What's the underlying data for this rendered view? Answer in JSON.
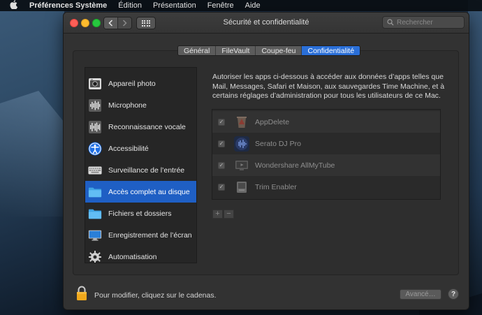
{
  "menubar": {
    "app_name": "Préférences Système",
    "items": [
      "Édition",
      "Présentation",
      "Fenêtre",
      "Aide"
    ]
  },
  "window": {
    "title": "Sécurité et confidentialité",
    "search_placeholder": "Rechercher"
  },
  "tabs": [
    {
      "label": "Général",
      "active": false
    },
    {
      "label": "FileVault",
      "active": false
    },
    {
      "label": "Coupe-feu",
      "active": false
    },
    {
      "label": "Confidentialité",
      "active": true
    }
  ],
  "sidebar": {
    "items": [
      {
        "label": "Appareil photo",
        "icon": "camera-icon",
        "selected": false
      },
      {
        "label": "Microphone",
        "icon": "microphone-icon",
        "selected": false
      },
      {
        "label": "Reconnaissance vocale",
        "icon": "speech-recognition-icon",
        "selected": false
      },
      {
        "label": "Accessibilité",
        "icon": "accessibility-icon",
        "selected": false
      },
      {
        "label": "Surveillance de l’entrée",
        "icon": "keyboard-icon",
        "selected": false
      },
      {
        "label": "Accès complet au disque",
        "icon": "folder-icon",
        "selected": true
      },
      {
        "label": "Fichiers et dossiers",
        "icon": "folder-icon",
        "selected": false
      },
      {
        "label": "Enregistrement de l’écran",
        "icon": "display-icon",
        "selected": false
      },
      {
        "label": "Automatisation",
        "icon": "gear-icon",
        "selected": false
      }
    ]
  },
  "main": {
    "description": "Autoriser les apps ci-dessous à accéder aux données d’apps telles que Mail, Messages, Safari et Maison, aux sauvegardes Time Machine, et à certains réglages d’administration pour tous les utilisateurs de ce Mac.",
    "apps": [
      {
        "name": "AppDelete",
        "checked": true,
        "icon": "appdelete-icon"
      },
      {
        "name": "Serato DJ Pro",
        "checked": true,
        "icon": "serato-icon"
      },
      {
        "name": "Wondershare AllMyTube",
        "checked": true,
        "icon": "allmytube-icon"
      },
      {
        "name": "Trim Enabler",
        "checked": true,
        "icon": "trim-enabler-icon"
      }
    ],
    "add_label": "+",
    "remove_label": "−"
  },
  "footer": {
    "lock_text": "Pour modifier, cliquez sur le cadenas.",
    "advanced_label": "Avancé…",
    "help_label": "?"
  },
  "colors": {
    "accent": "#2a6fd8",
    "selection": "#1f5fc4",
    "window_bg": "#323232"
  }
}
